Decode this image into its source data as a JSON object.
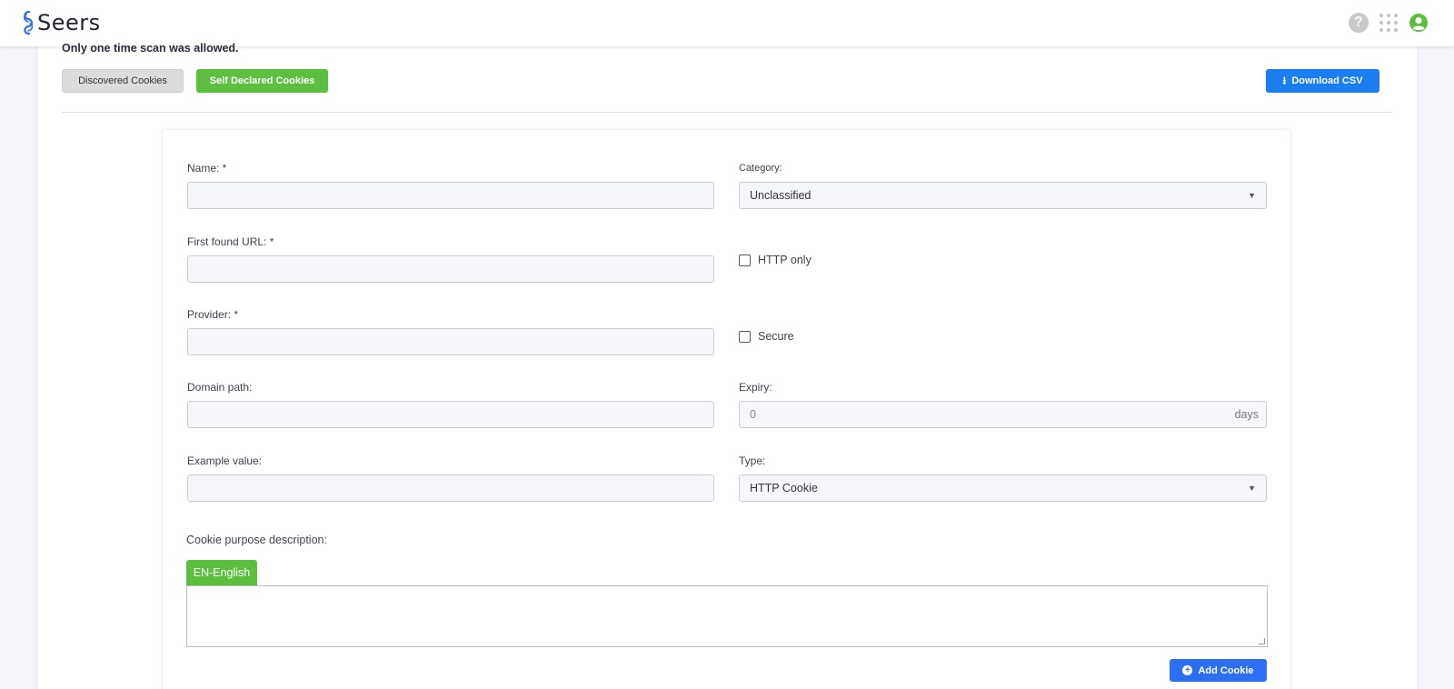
{
  "app": {
    "logo_text": "Seers",
    "brand_color": "#2b6fe8",
    "icons": [
      "help-icon",
      "apps-grid-icon",
      "user-account-icon"
    ]
  },
  "notice": "Only one time scan was allowed.",
  "toolbar": {
    "discovered_label": "Discovered Cookies",
    "self_declared_label": "Self Declared Cookies",
    "download_label": "Download CSV",
    "self_declared_color": "#5cbf3f",
    "download_color": "#1a7ef0"
  },
  "form": {
    "name_label": "Name: *",
    "name_value": "",
    "category_label": "Category:",
    "category_value": "Unclassified",
    "first_url_label": "First found URL: *",
    "first_url_value": "",
    "http_only_label": "HTTP only",
    "http_only_checked": false,
    "provider_label": "Provider: *",
    "provider_value": "",
    "secure_label": "Secure",
    "secure_checked": false,
    "domain_path_label": "Domain path:",
    "domain_path_value": "",
    "expiry_label": "Expiry:",
    "expiry_value": "0",
    "expiry_unit": "days",
    "example_value_label": "Example value:",
    "example_value_value": "",
    "type_label": "Type:",
    "type_value": "HTTP Cookie",
    "purpose_label": "Cookie purpose description:",
    "language_tab": "EN-English",
    "purpose_value": "",
    "add_button_label": "Add Cookie",
    "add_button_color": "#2c6ff2"
  }
}
